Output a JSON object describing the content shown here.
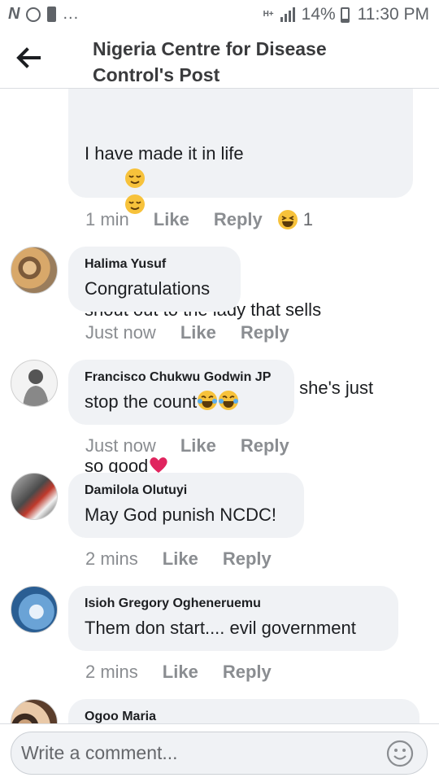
{
  "status_bar": {
    "left_icons": [
      "n-icon",
      "whatsapp-icon",
      "alert-icon"
    ],
    "overflow": "...",
    "network": "H+",
    "battery": "14%",
    "time": "11:30 PM"
  },
  "header": {
    "title_line1": "Nigeria Centre for Disease",
    "title_line2": "Control's Post"
  },
  "first_comment": {
    "line1": "I have made it in life",
    "line2": "shout out to the lady that sells",
    "line3": "abacha near my school..... she's just",
    "line4": "so good",
    "time": "1 min",
    "like": "Like",
    "reply": "Reply",
    "reaction_count": "1"
  },
  "comments": [
    {
      "author": "Halima Yusuf",
      "text": "Congratulations",
      "time": "Just now",
      "like": "Like",
      "reply": "Reply"
    },
    {
      "author": "Francisco Chukwu Godwin JP",
      "text": "stop the count",
      "time": "Just now",
      "like": "Like",
      "reply": "Reply"
    },
    {
      "author": "Damilola Olutuyi",
      "text": "May God punish NCDC!",
      "time": "2 mins",
      "like": "Like",
      "reply": "Reply"
    },
    {
      "author": "Isioh Gregory Ogheneruemu",
      "text": "Them don start.... evil government",
      "time": "2 mins",
      "like": "Like",
      "reply": "Reply"
    },
    {
      "author": "Ogoo Maria"
    }
  ],
  "composer": {
    "placeholder": "Write a comment..."
  },
  "colors": {
    "bubble": "#f0f2f5",
    "meta": "#8a8d91",
    "heart": "#e0245e",
    "emoji": "#f7c23b"
  }
}
